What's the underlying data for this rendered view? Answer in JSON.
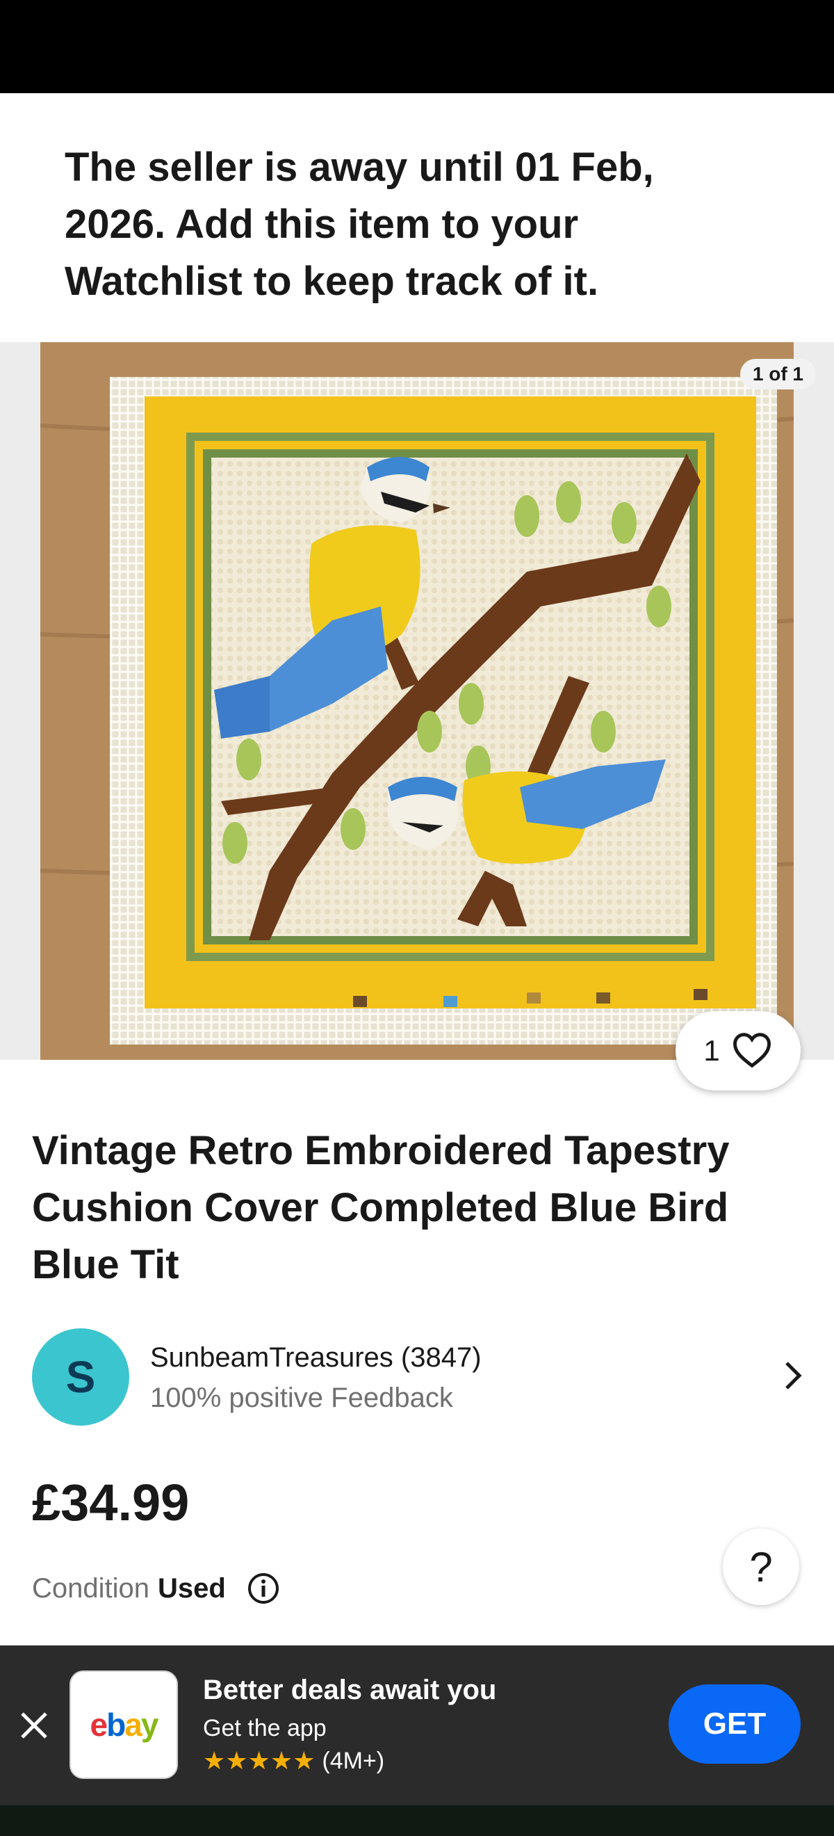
{
  "away_banner": {
    "message": "The seller is away until 01 Feb, 2026. Add this item to your Watchlist to keep track of it."
  },
  "gallery": {
    "counter": "1 of 1",
    "image_alt": "item-photo",
    "watch_count": "1"
  },
  "listing": {
    "title": "Vintage Retro Embroidered Tapestry Cushion Cover Completed Blue Bird Blue Tit",
    "price": "£34.99",
    "condition_label": "Condition",
    "condition_value": "Used"
  },
  "seller": {
    "avatar_letter": "S",
    "name": "SunbeamTreasures (3847)",
    "feedback": "100% positive Feedback"
  },
  "help": {
    "label": "?"
  },
  "app_banner": {
    "headline": "Better deals await you",
    "subtext": "Get the app",
    "stars": "★★★★★",
    "rating_count": "(4M+)",
    "get_label": "GET",
    "logo": {
      "e": "e",
      "b": "b",
      "a": "a",
      "y": "y"
    }
  },
  "colors": {
    "accent": "#0968f6",
    "avatar_bg": "#3bc5cf",
    "star": "#f5af02",
    "app_bar_bg": "#2b2b2b"
  },
  "icons": [
    "heart-icon",
    "chevron-right-icon",
    "info-icon",
    "close-icon",
    "star-icon"
  ]
}
